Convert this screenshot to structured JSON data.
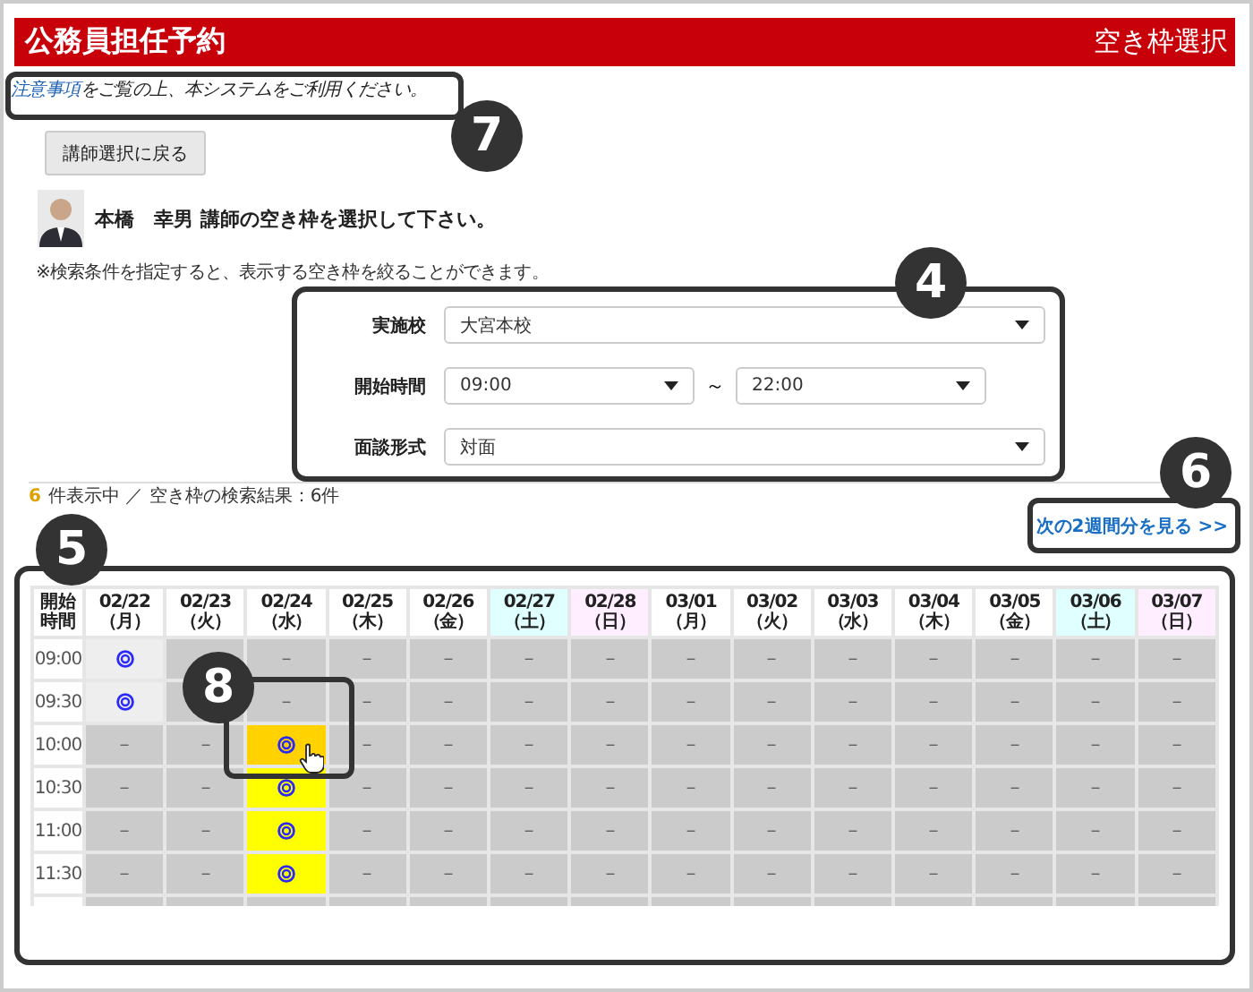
{
  "header": {
    "title": "公務員担任予約",
    "page": "空き枠選択"
  },
  "notice": {
    "link": "注意事項",
    "text": "をご覧の上、本システムをご利用ください。"
  },
  "back_button": "講師選択に戻る",
  "instructor_line": "本橋　幸男 講師の空き枠を選択して下さい。",
  "hint": "※検索条件を指定すると、表示する空き枠を絞ることができます。",
  "filters": [
    {
      "label": "実施校",
      "kind": "single",
      "value": "大宮本校"
    },
    {
      "label": "開始時間",
      "kind": "range",
      "from": "09:00",
      "separator": "～",
      "to": "22:00"
    },
    {
      "label": "面談形式",
      "kind": "single",
      "value": "対面"
    }
  ],
  "result": {
    "count": "6",
    "text": "件表示中 ／ 空き枠の検索結果：6件"
  },
  "next_link": "次の2週間分を見る >>",
  "schedule": {
    "time_header": "開始時間",
    "columns": [
      {
        "label": "02/22（月）",
        "color": "#ffffff"
      },
      {
        "label": "02/23（火）",
        "color": "#ffffff"
      },
      {
        "label": "02/24（水）",
        "color": "#ffffff"
      },
      {
        "label": "02/25（木）",
        "color": "#ffffff"
      },
      {
        "label": "02/26（金）",
        "color": "#ffffff"
      },
      {
        "label": "02/27（土）",
        "color": "#e0ffff"
      },
      {
        "label": "02/28（日）",
        "color": "#ffeeff"
      },
      {
        "label": "03/01（月）",
        "color": "#ffffff"
      },
      {
        "label": "03/02（火）",
        "color": "#ffffff"
      },
      {
        "label": "03/03（水）",
        "color": "#ffffff"
      },
      {
        "label": "03/04（木）",
        "color": "#ffffff"
      },
      {
        "label": "03/05（金）",
        "color": "#ffffff"
      },
      {
        "label": "03/06（土）",
        "color": "#e0ffff"
      },
      {
        "label": "03/07（日）",
        "color": "#ffeeff"
      }
    ],
    "rows": [
      {
        "time": "09:00",
        "cells": [
          {
            "kind": "available",
            "color": "#eeeeee"
          },
          {
            "kind": "none"
          },
          {
            "kind": "none",
            "text": "－"
          },
          {
            "kind": "none",
            "text": "－"
          },
          {
            "kind": "none",
            "text": "－"
          },
          {
            "kind": "none",
            "text": "－"
          },
          {
            "kind": "none",
            "text": "－"
          },
          {
            "kind": "none",
            "text": "－"
          },
          {
            "kind": "none",
            "text": "－"
          },
          {
            "kind": "none",
            "text": "－"
          },
          {
            "kind": "none",
            "text": "－"
          },
          {
            "kind": "none",
            "text": "－"
          },
          {
            "kind": "none",
            "text": "－"
          },
          {
            "kind": "none",
            "text": "－"
          }
        ]
      },
      {
        "time": "09:30",
        "cells": [
          {
            "kind": "available",
            "color": "#eeeeee"
          },
          {
            "kind": "none"
          },
          {
            "kind": "none",
            "text": "－"
          },
          {
            "kind": "none",
            "text": "－"
          },
          {
            "kind": "none",
            "text": "－"
          },
          {
            "kind": "none",
            "text": "－"
          },
          {
            "kind": "none",
            "text": "－"
          },
          {
            "kind": "none",
            "text": "－"
          },
          {
            "kind": "none",
            "text": "－"
          },
          {
            "kind": "none",
            "text": "－"
          },
          {
            "kind": "none",
            "text": "－"
          },
          {
            "kind": "none",
            "text": "－"
          },
          {
            "kind": "none",
            "text": "－"
          },
          {
            "kind": "none",
            "text": "－"
          }
        ]
      },
      {
        "time": "10:00",
        "cells": [
          {
            "kind": "none",
            "text": "－"
          },
          {
            "kind": "none",
            "text": "－"
          },
          {
            "kind": "available",
            "color": "#ffd200",
            "pointer": true
          },
          {
            "kind": "none",
            "text": "－"
          },
          {
            "kind": "none",
            "text": "－"
          },
          {
            "kind": "none",
            "text": "－"
          },
          {
            "kind": "none",
            "text": "－"
          },
          {
            "kind": "none",
            "text": "－"
          },
          {
            "kind": "none",
            "text": "－"
          },
          {
            "kind": "none",
            "text": "－"
          },
          {
            "kind": "none",
            "text": "－"
          },
          {
            "kind": "none",
            "text": "－"
          },
          {
            "kind": "none",
            "text": "－"
          },
          {
            "kind": "none",
            "text": "－"
          }
        ]
      },
      {
        "time": "10:30",
        "cells": [
          {
            "kind": "none",
            "text": "－"
          },
          {
            "kind": "none",
            "text": "－"
          },
          {
            "kind": "available",
            "color": "#ffff00"
          },
          {
            "kind": "none",
            "text": "－"
          },
          {
            "kind": "none",
            "text": "－"
          },
          {
            "kind": "none",
            "text": "－"
          },
          {
            "kind": "none",
            "text": "－"
          },
          {
            "kind": "none",
            "text": "－"
          },
          {
            "kind": "none",
            "text": "－"
          },
          {
            "kind": "none",
            "text": "－"
          },
          {
            "kind": "none",
            "text": "－"
          },
          {
            "kind": "none",
            "text": "－"
          },
          {
            "kind": "none",
            "text": "－"
          },
          {
            "kind": "none",
            "text": "－"
          }
        ]
      },
      {
        "time": "11:00",
        "cells": [
          {
            "kind": "none",
            "text": "－"
          },
          {
            "kind": "none",
            "text": "－"
          },
          {
            "kind": "available",
            "color": "#ffff00"
          },
          {
            "kind": "none",
            "text": "－"
          },
          {
            "kind": "none",
            "text": "－"
          },
          {
            "kind": "none",
            "text": "－"
          },
          {
            "kind": "none",
            "text": "－"
          },
          {
            "kind": "none",
            "text": "－"
          },
          {
            "kind": "none",
            "text": "－"
          },
          {
            "kind": "none",
            "text": "－"
          },
          {
            "kind": "none",
            "text": "－"
          },
          {
            "kind": "none",
            "text": "－"
          },
          {
            "kind": "none",
            "text": "－"
          },
          {
            "kind": "none",
            "text": "－"
          }
        ]
      },
      {
        "time": "11:30",
        "cells": [
          {
            "kind": "none",
            "text": "－"
          },
          {
            "kind": "none",
            "text": "－"
          },
          {
            "kind": "available",
            "color": "#ffff00"
          },
          {
            "kind": "none",
            "text": "－"
          },
          {
            "kind": "none",
            "text": "－"
          },
          {
            "kind": "none",
            "text": "－"
          },
          {
            "kind": "none",
            "text": "－"
          },
          {
            "kind": "none",
            "text": "－"
          },
          {
            "kind": "none",
            "text": "－"
          },
          {
            "kind": "none",
            "text": "－"
          },
          {
            "kind": "none",
            "text": "－"
          },
          {
            "kind": "none",
            "text": "－"
          },
          {
            "kind": "none",
            "text": "－"
          },
          {
            "kind": "none",
            "text": "－"
          }
        ]
      }
    ]
  },
  "callouts": [
    {
      "number": "7"
    },
    {
      "number": "4"
    },
    {
      "number": "6"
    },
    {
      "number": "5"
    },
    {
      "number": "8"
    }
  ]
}
